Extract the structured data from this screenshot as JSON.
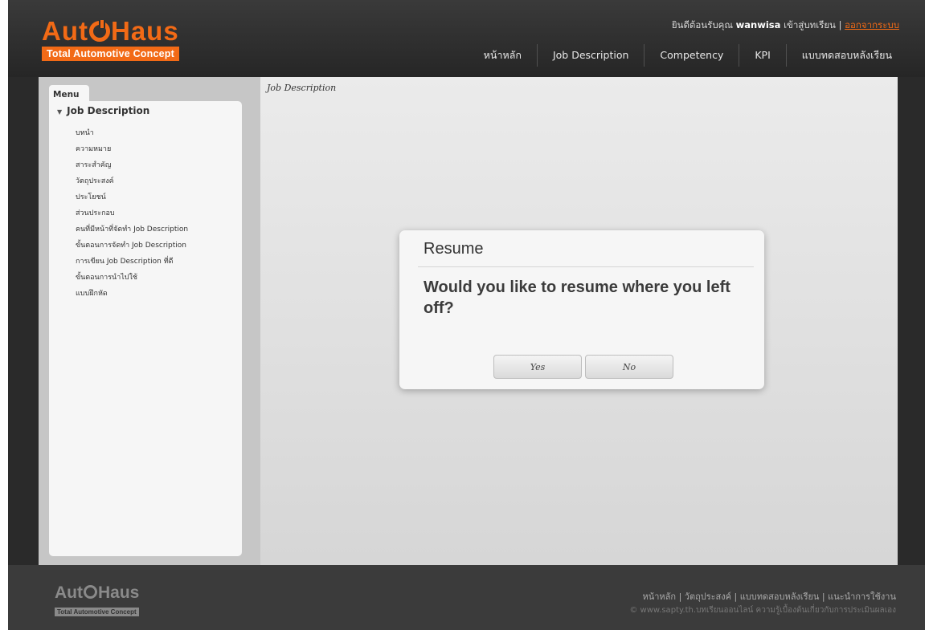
{
  "header": {
    "logo_pre": "Aut",
    "logo_post": "Haus",
    "logo_tagline": "Total Automotive Concept",
    "welcome_prefix": "ยินดีต้อนรับคุณ",
    "username": "wanwisa",
    "welcome_suffix": "เข้าสู่บทเรียน |",
    "logout": "ออกจากระบบ"
  },
  "nav": {
    "items": [
      "หน้าหลัก",
      "Job Description",
      "Competency",
      "KPI",
      "แบบทดสอบหลังเรียน"
    ]
  },
  "sidebar": {
    "menu_tab": "Menu",
    "section_title": "Job Description",
    "items": [
      "บทนำ",
      "ความหมาย",
      "สาระสำคัญ",
      "วัตถุประสงค์",
      "ประโยชน์",
      "ส่วนประกอบ",
      "คนที่มีหน้าที่จัดทำ Job Description",
      "ขั้นตอนการจัดทำ Job Description",
      "การเขียน Job Description ที่ดี",
      "ขั้นตอนการนำไปใช้",
      "แบบฝึกหัด"
    ]
  },
  "main": {
    "page_label": "Job Description"
  },
  "dialog": {
    "title": "Resume",
    "message": "Would you like to resume where you left off?",
    "yes_label": "Yes",
    "no_label": "No"
  },
  "footer": {
    "logo_pre": "Aut",
    "logo_post": "Haus",
    "logo_tagline": "Total Automotive Concept",
    "links": "หน้าหลัก | วัตถุประสงค์ | แบบทดสอบหลังเรียน | แนะนำการใช้งาน",
    "copyright": "© www.sapty.th.บทเรียนออนไลน์ ความรู้เบื้องต้นเกี่ยวกับการประเมินผลเอง"
  },
  "colors": {
    "brand_orange": "#f26a16",
    "header_bg": "#2e2e2e",
    "footer_bg": "#3b3b3b"
  }
}
